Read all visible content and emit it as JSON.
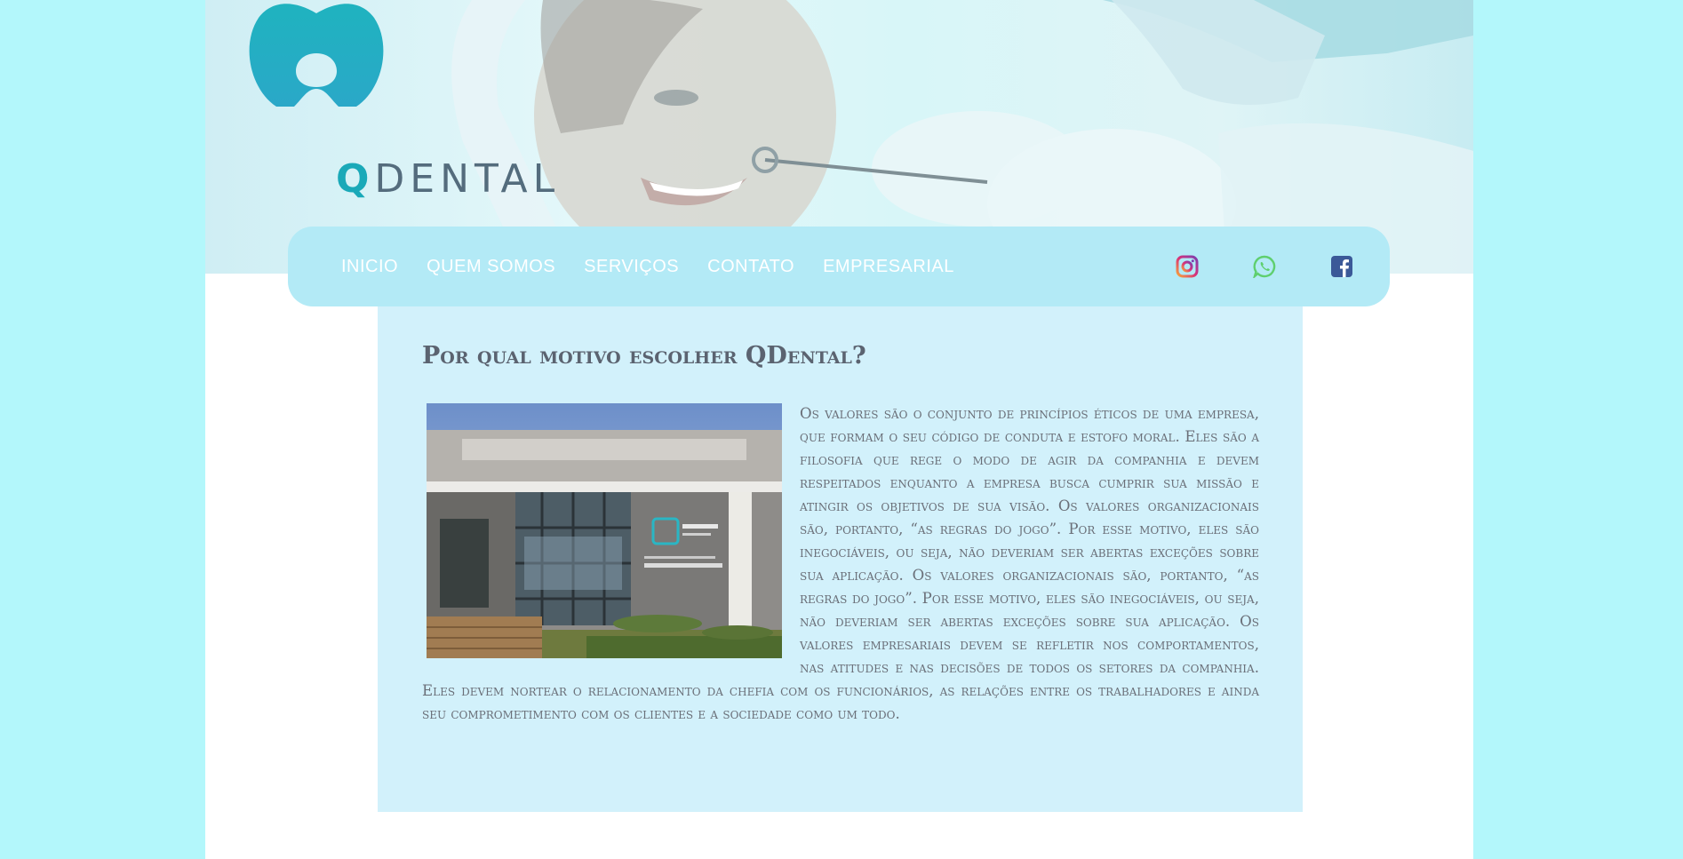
{
  "brand": {
    "name_prefix": "Q",
    "name_rest": "DENTAL",
    "colors": {
      "teal": "#1aa9b8",
      "slate": "#546c7d"
    }
  },
  "nav": {
    "items": [
      {
        "label": "INICIO"
      },
      {
        "label": "QUEM SOMOS"
      },
      {
        "label": "SERVIÇOS"
      },
      {
        "label": "CONTATO"
      },
      {
        "label": "EMPRESARIAL"
      }
    ]
  },
  "social": [
    {
      "icon": "instagram-icon"
    },
    {
      "icon": "whatsapp-icon"
    },
    {
      "icon": "facebook-icon"
    }
  ],
  "content": {
    "heading": "Por qual motivo escolher QDental?",
    "body": "Os valores são o conjunto de princípios éticos de uma empresa, que formam o seu código de conduta e estofo moral. Eles são a filosofia que rege o modo de agir da companhia e devem respeitados enquanto a empresa busca cumprir sua missão e atingir os objetivos de sua visão. Os valores organizacionais são, portanto, “as regras do jogo”. Por esse motivo, eles são inegociáveis, ou seja, não deveriam ser abertas exceções sobre sua aplicação. Os valores organizacionais são, portanto, “as regras do jogo”. Por esse motivo, eles são inegociáveis, ou seja, não deveriam ser abertas exceções sobre sua aplicação. Os valores empresariais devem se refletir nos comportamentos, nas atitudes e nas decisões de todos os setores da companhia. Eles devem nortear o relacionamento da chefia com os funcionários, as relações entre os trabalhadores e ainda seu comprometimento com os clientes e a sociedade como um todo."
  },
  "colors": {
    "page_bg": "#b3f7fb",
    "navbar_bg": "#b3eaf6",
    "content_bg": "#d2f1fb",
    "text": "#6a6f78"
  }
}
